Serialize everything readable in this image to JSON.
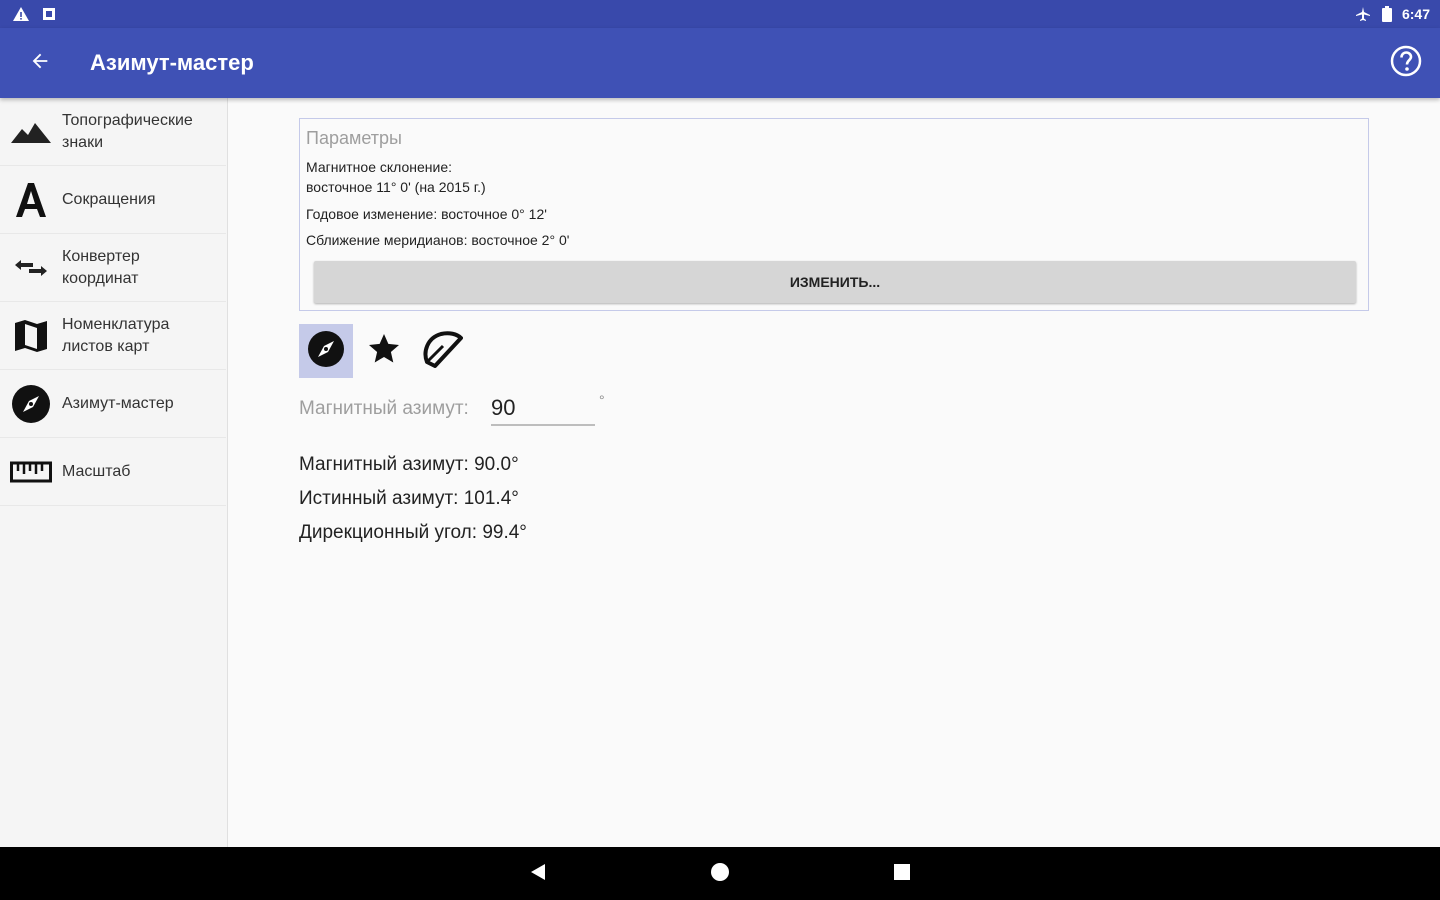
{
  "statusbar": {
    "left_icons": [
      "warning-icon",
      "notification-icon"
    ],
    "right_icons": [
      "airplane-mode-icon",
      "battery-icon"
    ],
    "time": "6:47"
  },
  "appbar": {
    "title": "Азимут-мастер",
    "back_icon": "arrow-back-icon",
    "help_icon": "help-circle-icon",
    "color": "#3f51b5"
  },
  "sidebar": {
    "items": [
      {
        "label": "Топографические знаки",
        "icon": "mountain-icon"
      },
      {
        "label": "Сокращения",
        "icon": "letter-a-icon"
      },
      {
        "label": "Конвертер координат",
        "icon": "swap-arrows-icon"
      },
      {
        "label": "Номенклатура листов карт",
        "icon": "map-icon"
      },
      {
        "label": "Азимут-мастер",
        "icon": "compass-icon"
      },
      {
        "label": "Масштаб",
        "icon": "ruler-icon"
      }
    ]
  },
  "params": {
    "title": "Параметры",
    "declination_line1": "Магнитное склонение:",
    "declination_line2": "восточное 11° 0' (на 2015 г.)",
    "annual_change": "Годовое изменение: восточное 0° 12'",
    "convergence": "Сближение меридианов: восточное 2° 0'",
    "change_button": "ИЗМЕНИТЬ..."
  },
  "modes": [
    {
      "icon": "compass-icon",
      "active": true
    },
    {
      "icon": "star-icon",
      "active": false
    },
    {
      "icon": "protractor-icon",
      "active": false
    }
  ],
  "input": {
    "label": "Магнитный азимут:",
    "value": "90",
    "unit": "°"
  },
  "results": {
    "magnetic": "Магнитный азимут: 90.0°",
    "true": "Истинный азимут: 101.4°",
    "grid": "Дирекционный угол: 99.4°"
  },
  "navbar": [
    "back-triangle-icon",
    "home-circle-icon",
    "recents-square-icon"
  ]
}
